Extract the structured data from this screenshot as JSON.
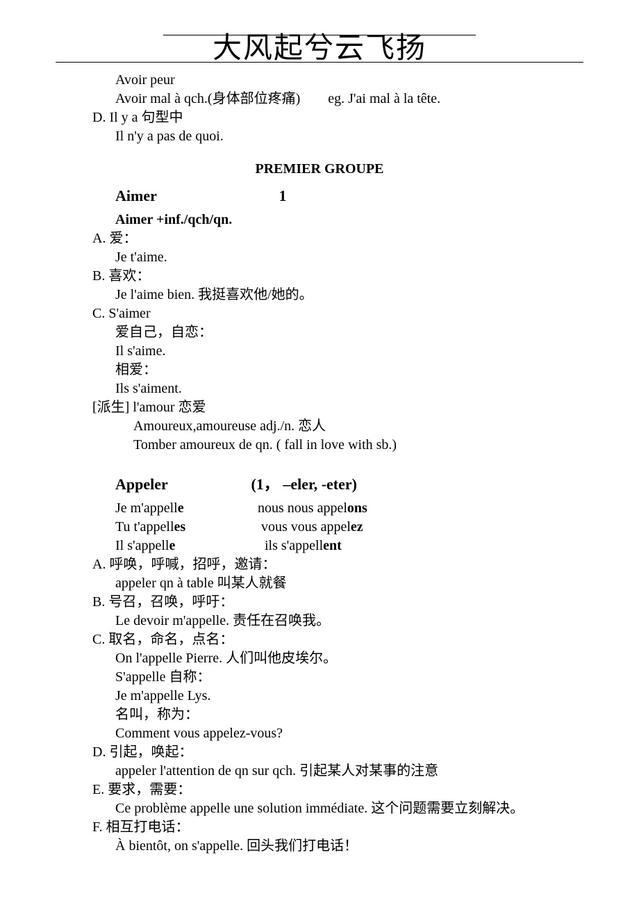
{
  "header": {
    "title": "大风起兮云飞扬"
  },
  "intro": {
    "line1": "Avoir peur",
    "line2a": "Avoir mal à qch.(身体部位疼痛)",
    "line2b": "eg. J'ai mal à la tête.",
    "d_marker": "D.",
    "d_head": "Il y a  句型中",
    "d_ex": "Il n'y a pas de quoi."
  },
  "section1_title": "PREMIER GROUPE",
  "aimer": {
    "head_left": "Aimer",
    "head_right": "1",
    "sub": "Aimer +inf./qch/qn.",
    "a_marker": "A.",
    "a_head": "爱：",
    "a_ex": "Je t'aime.",
    "b_marker": "B.",
    "b_head": "喜欢：",
    "b_ex": "Je l'aime bien.  我挺喜欢他/她的。",
    "c_marker": "C.",
    "c_head": "S'aimer",
    "c_l1": "爱自己，自恋：",
    "c_l2": "Il s'aime.",
    "c_l3": "相爱：",
    "c_l4": "Ils s'aiment.",
    "deriv1": "[派生] l'amour  恋爱",
    "deriv2": "Amoureux,amoureuse    adj./n.  恋人",
    "deriv3": "Tomber amoureux de qn. ( fall in love with sb.)"
  },
  "appeler": {
    "head_left": "Appeler",
    "head_right": "(1，  –eler, -eter)",
    "conj": {
      "r1l_a": "Je m'appell",
      "r1l_b": "e",
      "r1r_a": "nous nous appel",
      "r1r_b": "ons",
      "r2l_a": "Tu t'appell",
      "r2l_b": "es",
      "r2r_a": "vous vous appel",
      "r2r_b": "ez",
      "r3l_a": "Il s'appell",
      "r3l_b": "e",
      "r3r_a": "ils s'appell",
      "r3r_b": "ent"
    },
    "a_marker": "A.",
    "a_head": "呼唤，呼喊，招呼，邀请：",
    "a_ex": "appeler qn à table  叫某人就餐",
    "b_marker": "B.",
    "b_head": "号召，召唤，呼吁：",
    "b_ex": "Le devoir m'appelle.  责任在召唤我。",
    "c_marker": "C.",
    "c_head": "取名，命名，点名：",
    "c_l1": "On l'appelle Pierre.  人们叫他皮埃尔。",
    "c_l2": "S'appelle 自称：",
    "c_l3": "Je m'appelle Lys.",
    "c_l4": "名叫，称为：",
    "c_l5": "Comment vous appelez-vous?",
    "d_marker": "D.",
    "d_head": "引起，唤起：",
    "d_ex": "appeler l'attention de qn sur qch.  引起某人对某事的注意",
    "e_marker": "E.",
    "e_head": "要求，需要：",
    "e_ex": "Ce problème appelle une solution immédiate.  这个问题需要立刻解决。",
    "f_marker": "F.",
    "f_head": "相互打电话：",
    "f_ex": "À bientôt, on s'appelle.  回头我们打电话！"
  }
}
